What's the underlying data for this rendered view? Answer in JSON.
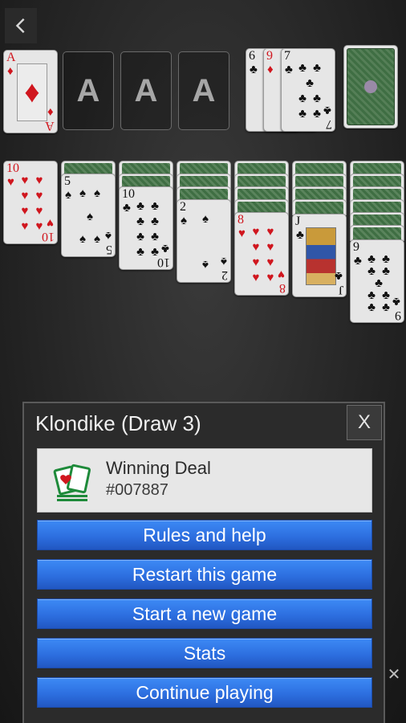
{
  "icons": {
    "back": "chevron-left-icon",
    "close": "close-icon",
    "deal": "cards-icon"
  },
  "colors": {
    "button_blue": "#2d6fe0",
    "card_red": "#d0161e",
    "card_back_green": "#3f6e43"
  },
  "foundations": [
    {
      "rank": "A",
      "suit": "♦",
      "color": "red"
    },
    {
      "placeholder": "A"
    },
    {
      "placeholder": "A"
    },
    {
      "placeholder": "A"
    }
  ],
  "waste": [
    {
      "rank": "6",
      "suit": "♣"
    },
    {
      "rank": "9",
      "suit": "♦"
    },
    {
      "rank": "7",
      "suit": "♣"
    }
  ],
  "tableau": [
    {
      "rank": "10",
      "suit": "♥",
      "color": "red"
    },
    {
      "rank": "5",
      "suit": "♠",
      "color": "black"
    },
    {
      "rank": "10",
      "suit": "♣",
      "color": "black"
    },
    {
      "rank": "2",
      "suit": "♠",
      "color": "black"
    },
    {
      "rank": "8",
      "suit": "♥",
      "color": "red"
    },
    {
      "rank": "J",
      "suit": "♣",
      "color": "black"
    },
    {
      "rank": "9",
      "suit": "♣",
      "color": "black"
    }
  ],
  "dialog": {
    "title": "Klondike (Draw 3)",
    "close_label": "X",
    "deal_title": "Winning Deal",
    "deal_number": "#007887",
    "buttons": [
      "Rules and help",
      "Restart this game",
      "Start a new game",
      "Stats",
      "Continue playing"
    ]
  },
  "ad_close_label": "✕"
}
